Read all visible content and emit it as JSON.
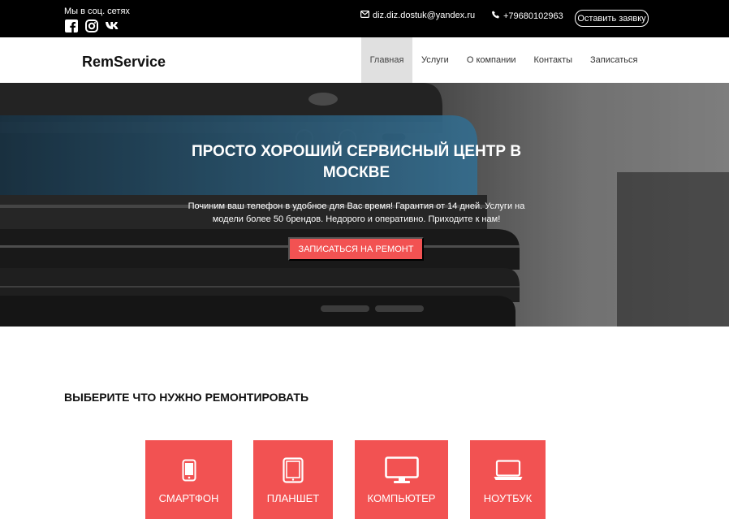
{
  "topbar": {
    "social_label": "Мы в соц. сетях",
    "social_icons": [
      "facebook-icon",
      "instagram-icon",
      "vk-icon"
    ],
    "email": "diz.diz.dostuk@yandex.ru",
    "phone": "+79680102963",
    "cta_label": "Оставить заявку"
  },
  "header": {
    "logo": "RemService",
    "nav": [
      "Главная",
      "Услуги",
      "О компании",
      "Контакты",
      "Записаться"
    ],
    "active_nav": "Главная"
  },
  "hero": {
    "title": "ПРОСТО ХОРОШИЙ СЕРВИСНЫЙ ЦЕНТР В МОСКВЕ",
    "text": "Починим ваш телефон в удобное для Вас время! Гарантия от 14 дней. Услуги на модели более 50 брендов. Недорого и оперативно. Приходите к нам!",
    "button": "ЗАПИСАТЬСЯ НА РЕМОНТ"
  },
  "section": {
    "title": "ВЫБЕРИТЕ ЧТО НУЖНО РЕМОНТИРОВАТЬ",
    "tiles": [
      {
        "label": "СМАРТФОН",
        "icon": "smartphone-icon"
      },
      {
        "label": "ПЛАНШЕТ",
        "icon": "tablet-icon"
      },
      {
        "label": "КОМПЬЮТЕР",
        "icon": "desktop-icon"
      },
      {
        "label": "НОУТБУК",
        "icon": "laptop-icon"
      }
    ]
  },
  "colors": {
    "accent": "#f25252",
    "topbar": "#000000",
    "nav_active_bg": "#e0e0e0"
  }
}
